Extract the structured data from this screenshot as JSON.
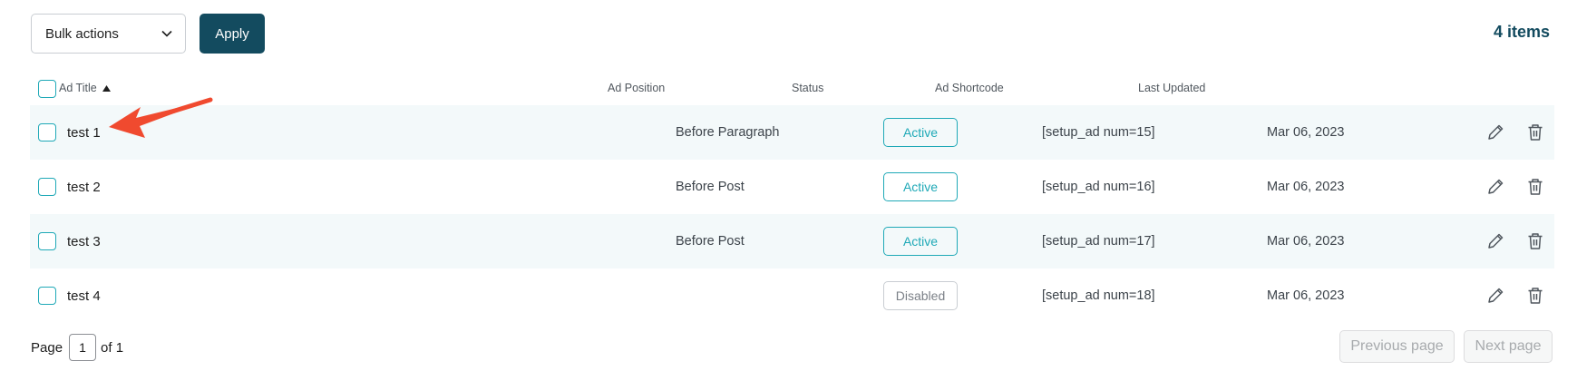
{
  "toolbar": {
    "bulk_actions_label": "Bulk actions",
    "apply_label": "Apply",
    "item_count": "4 items"
  },
  "table": {
    "headers": {
      "title": "Ad Title",
      "position": "Ad Position",
      "status": "Status",
      "shortcode": "Ad Shortcode",
      "updated": "Last Updated"
    },
    "rows": [
      {
        "title": "test 1",
        "position": "Before Paragraph",
        "status": "Active",
        "shortcode": "[setup_ad num=15]",
        "updated": "Mar 06, 2023"
      },
      {
        "title": "test 2",
        "position": "Before Post",
        "status": "Active",
        "shortcode": "[setup_ad num=16]",
        "updated": "Mar 06, 2023"
      },
      {
        "title": "test 3",
        "position": "Before Post",
        "status": "Active",
        "shortcode": "[setup_ad num=17]",
        "updated": "Mar 06, 2023"
      },
      {
        "title": "test 4",
        "position": "",
        "status": "Disabled",
        "shortcode": "[setup_ad num=18]",
        "updated": "Mar 06, 2023"
      }
    ]
  },
  "pagination": {
    "page_label": "Page",
    "current_page": "1",
    "of_label": "of 1",
    "prev_label": "Previous page",
    "next_label": "Next page"
  },
  "colors": {
    "accent": "#1fa9b7",
    "primary": "#134b5f",
    "annotation_arrow": "#f04a2f"
  },
  "icons": [
    "chevron-down-icon",
    "sort-ascending-icon",
    "pencil-icon",
    "trash-icon"
  ]
}
